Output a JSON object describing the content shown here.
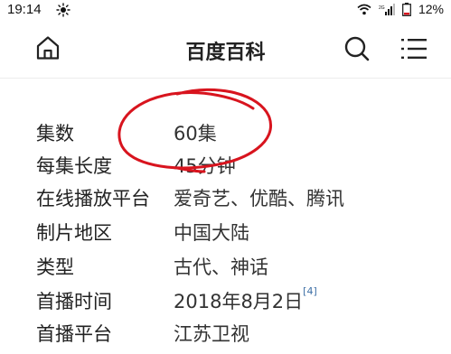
{
  "status": {
    "time": "19:14",
    "battery": "12%",
    "icons": [
      "sun-icon",
      "wifi-icon",
      "signal-icon",
      "battery-icon"
    ]
  },
  "app": {
    "title": "百度百科",
    "icons": [
      "home-icon",
      "search-icon",
      "menu-icon"
    ]
  },
  "info_rows": [
    {
      "key": "集数",
      "value": "60集"
    },
    {
      "key": "每集长度",
      "value": "45分钟"
    },
    {
      "key": "在线播放平台",
      "value": "爱奇艺、优酷、腾讯"
    },
    {
      "key": "制片地区",
      "value": "中国大陆"
    },
    {
      "key": "类型",
      "value": "古代、神话"
    },
    {
      "key": "首播时间",
      "value": "2018年8月2日",
      "ref": "[4]"
    },
    {
      "key": "首播平台",
      "value": "江苏卫视"
    }
  ],
  "colors": {
    "annotation": "#d8141e",
    "reference_link": "#3b6ea5",
    "text": "#222222"
  }
}
